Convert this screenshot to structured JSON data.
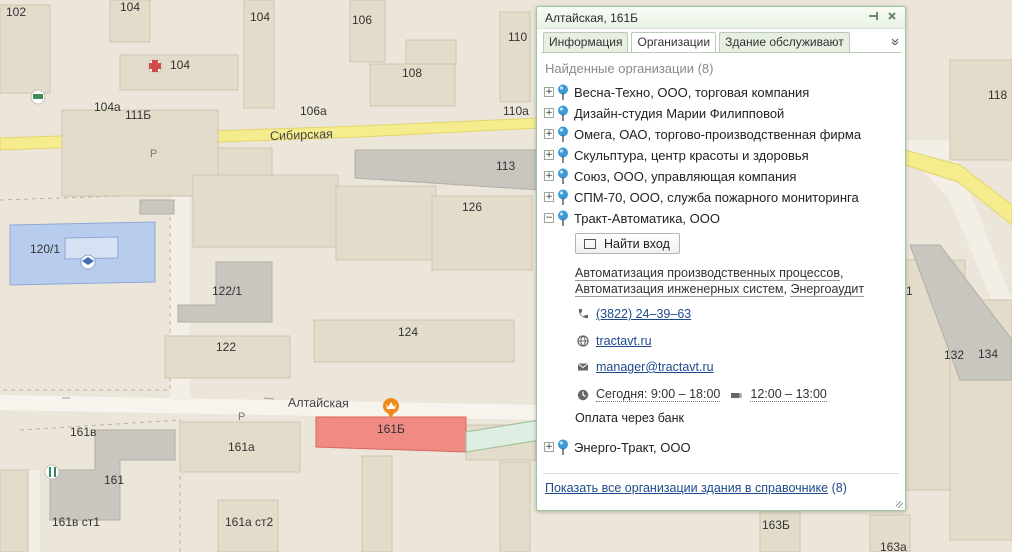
{
  "map": {
    "streets": [
      "Сибирская",
      "Алтайская"
    ],
    "buildings": [
      "102",
      "104",
      "104",
      "104",
      "106",
      "108",
      "110",
      "118",
      "104а",
      "111Б",
      "106а",
      "110а",
      "113",
      "126",
      "120/1",
      "122/1",
      "124",
      "122",
      "132",
      "134",
      "1",
      "161Б",
      "161в",
      "161а",
      "161",
      "161в ст1",
      "161а ст2",
      "163Б",
      "163а",
      "Р",
      "Р"
    ],
    "colors": {
      "ground": "#ece6da",
      "building": "#e3dccb",
      "building_dark": "#cfc6b3",
      "road": "#f4f1ea",
      "main_road": "#f5ee9a",
      "highlight": "#ef8b82",
      "school": "#b8cdee"
    },
    "icons": [
      "medical-cross-icon",
      "hotel-icon",
      "school-icon",
      "restaurant-icon",
      "building-pin-icon"
    ]
  },
  "popup": {
    "title": "Алтайская, 161Б",
    "tabs": [
      "Информация",
      "Организации",
      "Здание обслуживают"
    ],
    "active_tab": "Организации",
    "found_label": "Найденные организации (8)",
    "organizations": [
      "Весна-Техно, ООО, торговая компания",
      "Дизайн-студия Марии Филипповой",
      "Омега, ОАО, торгово-производственная фирма",
      "Скульптура, центр красоты и здоровья",
      "Союз, ООО, управляющая компания",
      "СПМ-70, ООО, служба пожарного мониторинга",
      "Тракт-Автоматика, ООО",
      "Энерго-Тракт, ООО"
    ],
    "expanded": {
      "find_entrance": "Найти вход",
      "rubrics": [
        "Автоматизация производственных процессов",
        "Автоматизация инженерных систем",
        "Энергоаудит"
      ],
      "phone": "(3822) 24–39–63",
      "website": "tractavt.ru",
      "email": "manager@tractavt.ru",
      "hours_label": "Сегодня:",
      "hours": "9:00 – 18:00",
      "lunch": "12:00 – 13:00",
      "payment": "Оплата через банк"
    },
    "footer_link": "Показать все организации здания в справочнике",
    "footer_count": "(8)",
    "colors": {
      "border": "#9ec79e",
      "link": "#1e4a8c",
      "pin": "#3a9bd6"
    }
  }
}
